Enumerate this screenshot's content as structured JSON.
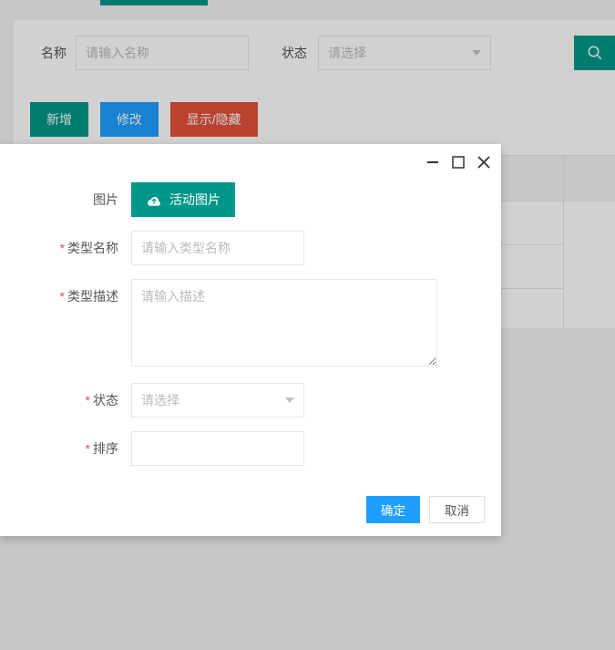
{
  "filter": {
    "name_label": "名称",
    "name_placeholder": "请输入名称",
    "status_label": "状态",
    "status_placeholder": "请选择"
  },
  "toolbar": {
    "add": "新增",
    "edit": "修改",
    "toggle": "显示/隐藏"
  },
  "dialog": {
    "image_label": "图片",
    "upload_label": "活动图片",
    "type_name_label": "类型名称",
    "type_name_placeholder": "请输入类型名称",
    "type_desc_label": "类型描述",
    "type_desc_placeholder": "请输入描述",
    "status_label": "状态",
    "status_placeholder": "请选择",
    "sort_label": "排序",
    "confirm": "确定",
    "cancel": "取消"
  }
}
